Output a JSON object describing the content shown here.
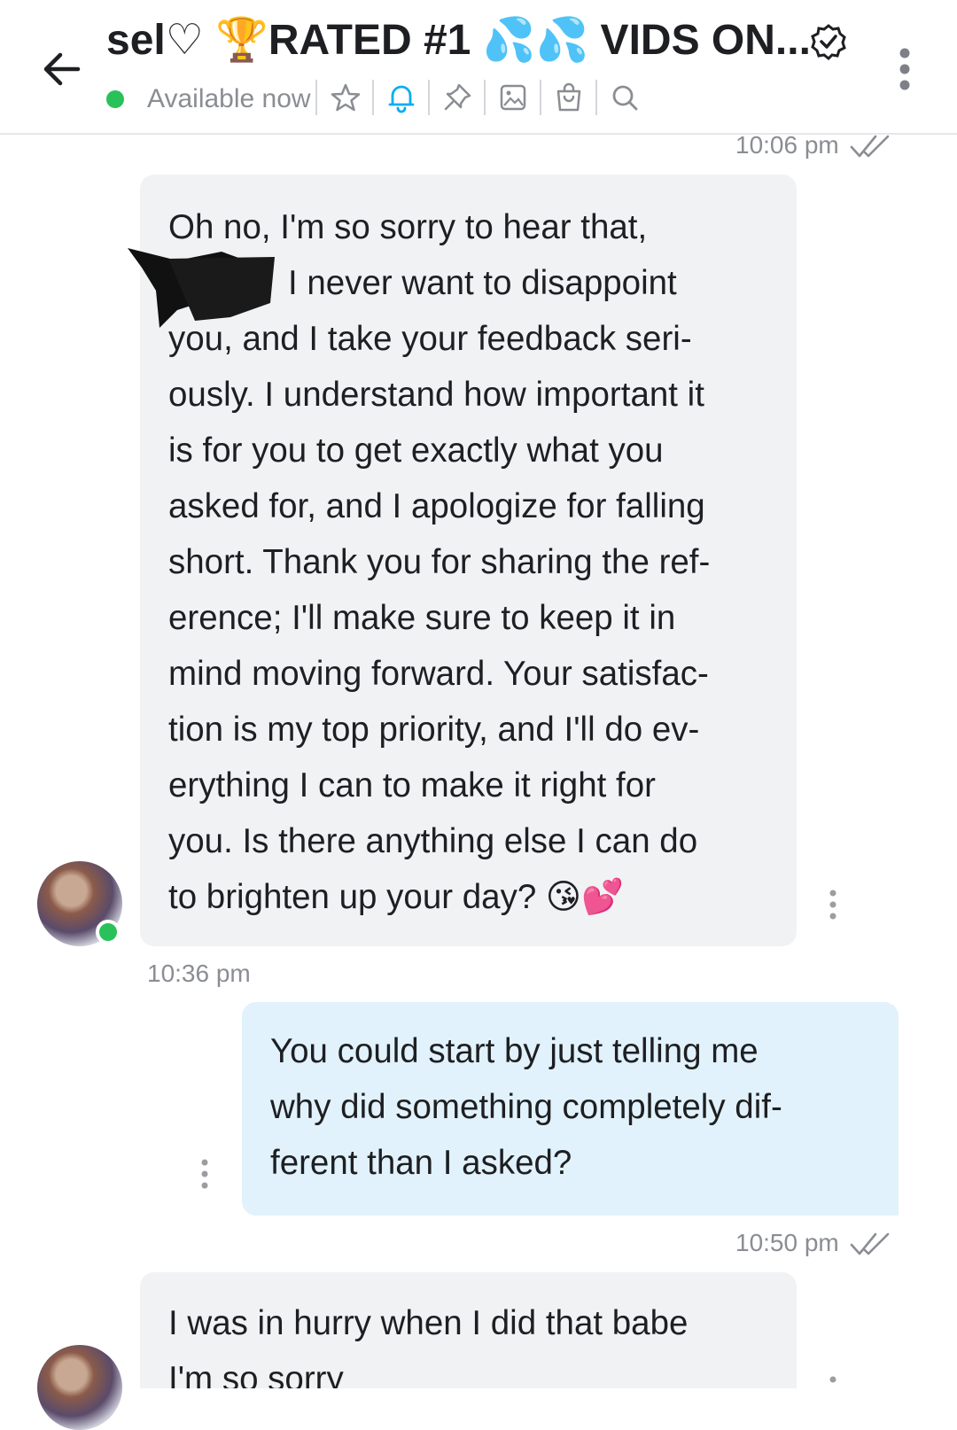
{
  "header": {
    "title": "sel♡ 🏆RATED #1 💦💦 VIDS ON...",
    "status": "Available now",
    "status_color": "#29c15a",
    "toolbar_icons": [
      "star-icon",
      "bell-icon",
      "pin-icon",
      "image-icon",
      "shopping-bag-icon",
      "search-icon"
    ]
  },
  "messages": [
    {
      "time": "10:06 pm",
      "direction": "incoming",
      "lines": [
        "Oh no, I'm so sorry to hear that,",
        "I never want to disappoint",
        "you, and I take your feedback seri-",
        "ously. I understand how important it",
        "is for you to get exactly what you",
        "asked for, and I apologize for falling",
        "short. Thank you for sharing the ref-",
        "erence; I'll make sure to keep it in",
        "mind moving forward. Your satisfac-",
        "tion is my top priority, and I'll do ev-",
        "erything I can to make it right for",
        "you. Is there anything else I can do",
        "to brighten up your day? 😘💕"
      ]
    },
    {
      "time": "10:36 pm",
      "direction": "outgoing",
      "lines": [
        "You could start by just telling me",
        "why did something completely dif-",
        "ferent than I asked?"
      ]
    },
    {
      "time": "10:50 pm",
      "direction": "incoming",
      "lines": [
        "I was in hurry when I did that babe",
        "I'm so sorry"
      ]
    }
  ],
  "colors": {
    "incoming_bubble": "#f1f2f4",
    "outgoing_bubble": "#e1f2fc",
    "accent": "#00aff0"
  }
}
